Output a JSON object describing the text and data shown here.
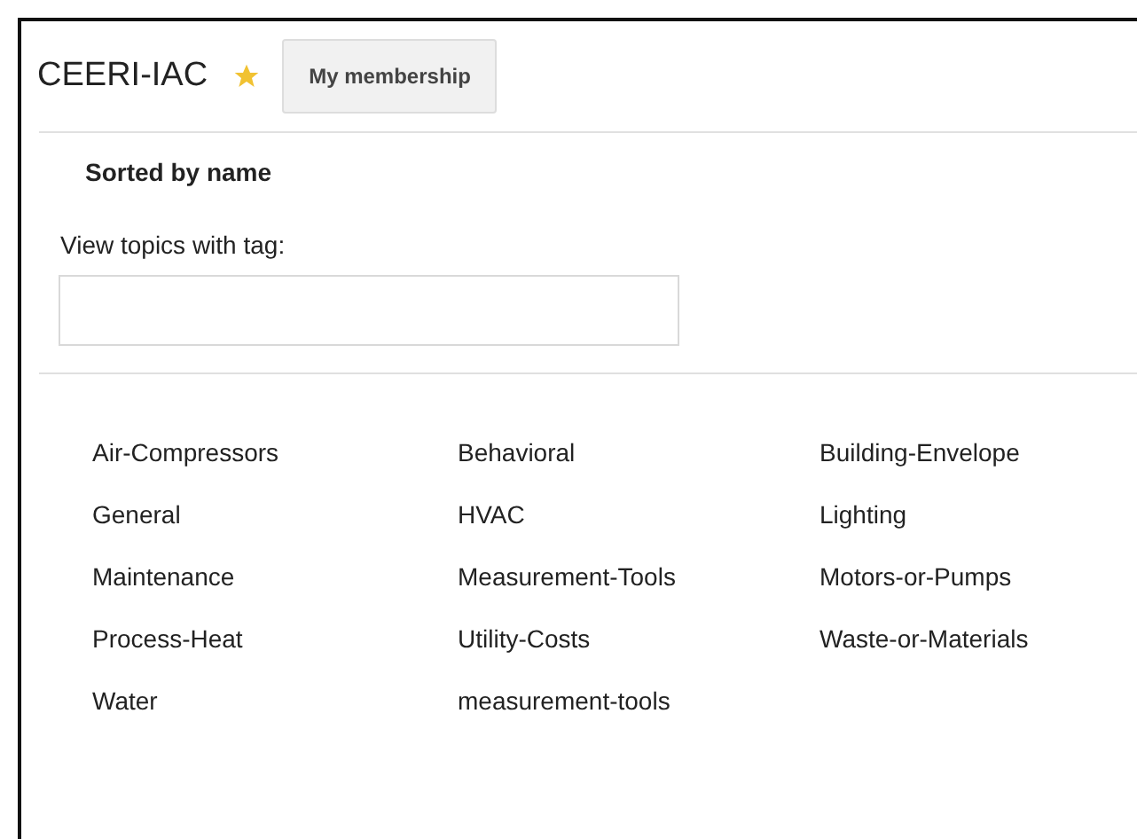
{
  "header": {
    "title": "CEERI-IAC",
    "starred": true,
    "membership_button": "My membership"
  },
  "sort_label": "Sorted by name",
  "tag_filter": {
    "label": "View topics with tag:"
  },
  "tags": [
    "Air-Compressors",
    "Behavioral",
    "Building-Envelope",
    "General",
    "HVAC",
    "Lighting",
    "Maintenance",
    "Measurement-Tools",
    "Motors-or-Pumps",
    "Process-Heat",
    "Utility-Costs",
    "Waste-or-Materials",
    "Water",
    "measurement-tools"
  ]
}
